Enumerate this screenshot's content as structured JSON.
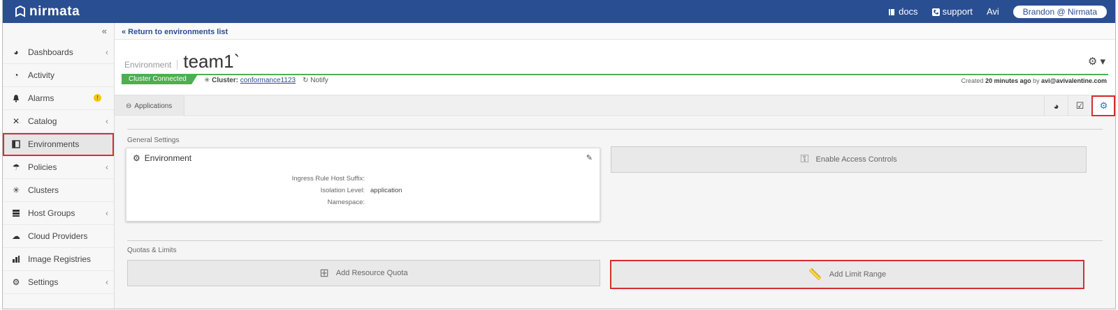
{
  "app": {
    "brand": "nirmata"
  },
  "topbar": {
    "docs": "docs",
    "support": "support",
    "user_short": "Avi",
    "user_account": "Brandon @ Nirmata"
  },
  "sidebar": {
    "collapse_glyph": "«",
    "items": [
      {
        "label": "Dashboards",
        "icon": "dashboard-icon",
        "chevron": true
      },
      {
        "label": "Activity",
        "icon": "activity-icon",
        "chevron": false
      },
      {
        "label": "Alarms",
        "icon": "bell-icon",
        "chevron": false,
        "badge": "!"
      },
      {
        "label": "Catalog",
        "icon": "catalog-icon",
        "chevron": true
      },
      {
        "label": "Environments",
        "icon": "environments-icon",
        "chevron": false,
        "active": true
      },
      {
        "label": "Policies",
        "icon": "umbrella-icon",
        "chevron": true
      },
      {
        "label": "Clusters",
        "icon": "clusters-icon",
        "chevron": false
      },
      {
        "label": "Host Groups",
        "icon": "hostgroups-icon",
        "chevron": true
      },
      {
        "label": "Cloud Providers",
        "icon": "cloud-icon",
        "chevron": false
      },
      {
        "label": "Image Registries",
        "icon": "registry-icon",
        "chevron": false
      },
      {
        "label": "Settings",
        "icon": "cogs-icon",
        "chevron": true
      }
    ]
  },
  "breadcrumb": {
    "back_label": "« Return to environments list"
  },
  "environment": {
    "label": "Environment",
    "name": "team1`",
    "status": "Cluster Connected",
    "cluster_label": "Cluster:",
    "cluster_name": "conformance1123",
    "notify": "Notify",
    "created_prefix": "Created",
    "created_when": "20 minutes ago",
    "created_by_prefix": "by",
    "created_by": "avi@avivalentine.com"
  },
  "tabs": {
    "applications": "Applications"
  },
  "general": {
    "section_title": "General Settings",
    "card_title": "Environment",
    "rows": [
      {
        "key": "Ingress Rule Host Suffix:",
        "value": ""
      },
      {
        "key": "Isolation Level:",
        "value": "application"
      },
      {
        "key": "Namespace:",
        "value": ""
      }
    ],
    "access_button": "Enable Access Controls"
  },
  "quotas": {
    "section_title": "Quotas & Limits",
    "resource_quota_button": "Add Resource Quota",
    "limit_range_button": "Add Limit Range"
  },
  "colors": {
    "topbar": "#2a4e92",
    "status_green": "#4caf50",
    "highlight_red": "#d32f2f"
  }
}
